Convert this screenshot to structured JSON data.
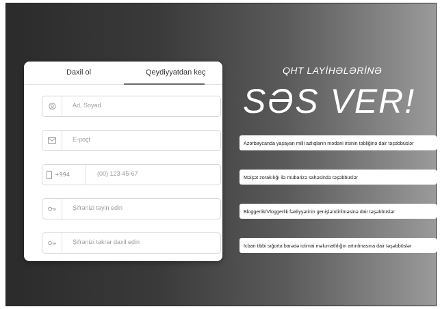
{
  "tabs": {
    "login": "Daxil ol",
    "register": "Qeydiyyatdan keç"
  },
  "form": {
    "name_placeholder": "Ad, Soyad",
    "email_placeholder": "E-poçt",
    "phone_prefix": "+994",
    "phone_placeholder": "(00) 123-45-67",
    "password_placeholder": "Şifrənizi təyin edin",
    "password_repeat_placeholder": "Şifrənizi təkrar daxil edin"
  },
  "promo": {
    "subtitle": "QHT LAYİHƏLƏRİNƏ",
    "title": "SƏS VER!"
  },
  "initiatives": [
    "Azərbaycanda yaşayan milli azlıqların mədəni irsinin təbliğinə dair təşəbbüslər",
    "Məişət zorakılığı ilə mübarizə sahəsində təşəbbüslər",
    "Bloggerlik/Vloggerlik fəaliyyətinin genişləndirilməsinə dair təşəbbüslər",
    "İcbari tibbi sığorta barədə ictimai məlumatlılığın artırılmasına dair təşəbbüslər"
  ],
  "icons": {
    "name": "user-icon",
    "email": "envelope-icon",
    "phone": "phone-icon",
    "password": "key-icon",
    "password_repeat": "key-icon"
  }
}
